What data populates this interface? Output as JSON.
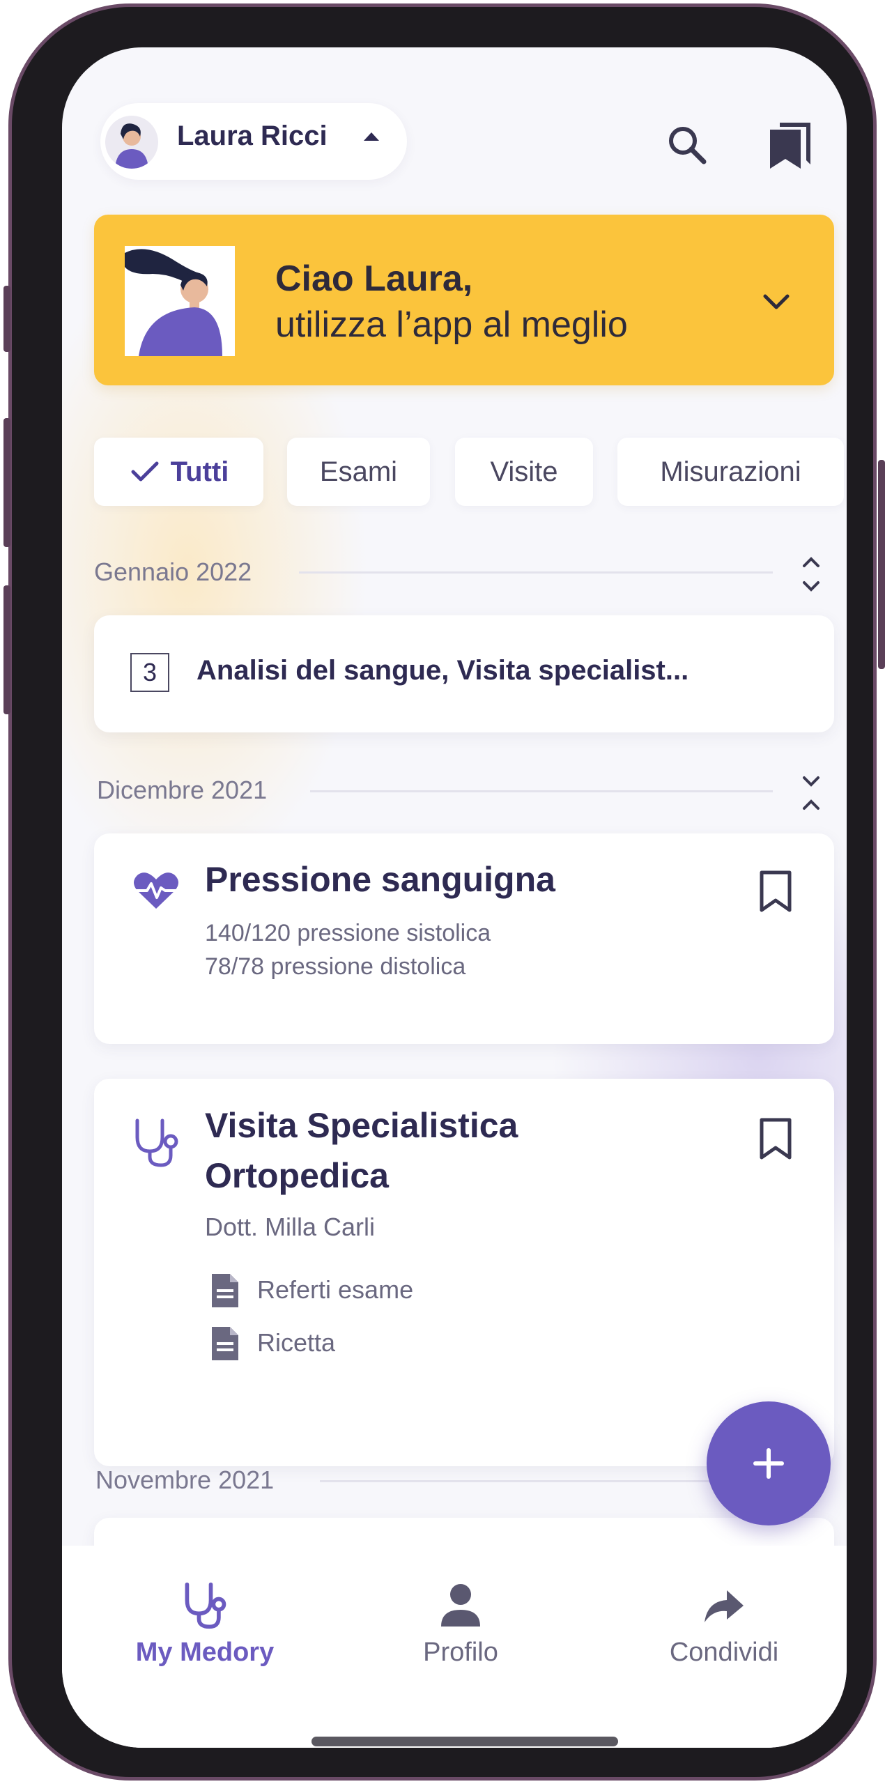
{
  "header": {
    "profile_name": "Laura Ricci",
    "icons": [
      "search-icon",
      "bookmarks-icon"
    ]
  },
  "banner": {
    "title": "Ciao Laura,",
    "subtitle": "utilizza l’app al meglio",
    "color": "#fbc43c"
  },
  "filters": [
    {
      "label": "Tutti",
      "selected": true
    },
    {
      "label": "Esami",
      "selected": false
    },
    {
      "label": "Visite",
      "selected": false
    },
    {
      "label": "Misurazioni",
      "selected": false
    }
  ],
  "timeline": {
    "jan_2022": {
      "month": "Gennaio 2022",
      "count": "3",
      "summary": "Analisi del sangue, Visita specialist..."
    },
    "dec_2021": {
      "month": "Dicembre 2021",
      "pressure": {
        "title": "Pressione sanguigna",
        "line1": "140/120 pressione sistolica",
        "line2": "78/78 pressione distolica"
      },
      "visit": {
        "title_line1": "Visita Specialistica",
        "title_line2": "Ortopedica",
        "doctor": "Dott. Milla Carli",
        "attachments": [
          "Referti esame",
          "Ricetta"
        ]
      }
    },
    "nov_2021": {
      "month": "Novembre 2021"
    }
  },
  "fab": {
    "icon": "plus-icon"
  },
  "bottom_nav": [
    {
      "label": "My Medory",
      "icon": "stethoscope-icon",
      "active": true
    },
    {
      "label": "Profilo",
      "icon": "person-icon",
      "active": false
    },
    {
      "label": "Condividi",
      "icon": "share-icon",
      "active": false
    }
  ],
  "colors": {
    "accent": "#6b5bc0",
    "text_dark": "#2e2a52",
    "background": "#f7f7fb"
  }
}
